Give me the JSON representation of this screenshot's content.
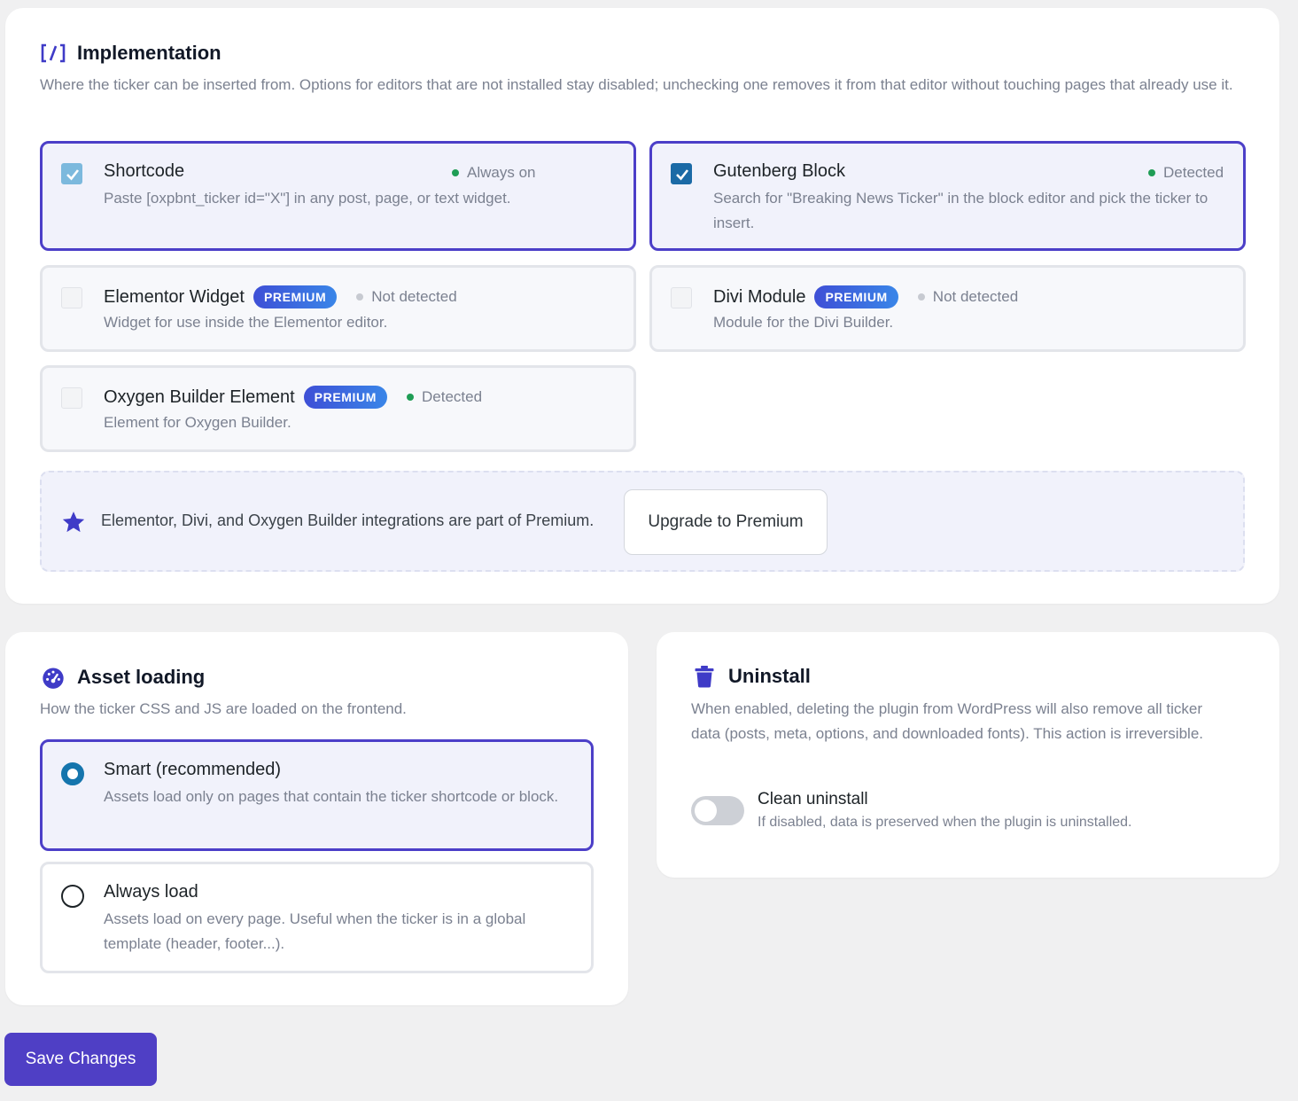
{
  "implementation": {
    "title": "Implementation",
    "description": "Where the ticker can be inserted from. Options for editors that are not installed stay disabled; unchecking one removes it from that editor without touching pages that already use it.",
    "options": [
      {
        "title": "Shortcode",
        "status": "Always on",
        "description": "Paste [oxpbnt_ticker id=\"X\"] in any post, page, or text widget.",
        "checked": true
      },
      {
        "title": "Gutenberg Block",
        "status": "Detected",
        "description": "Search for \"Breaking News Ticker\" in the block editor and pick the ticker to insert.",
        "checked": true
      },
      {
        "title": "Elementor Widget",
        "badge": "PREMIUM",
        "status": "Not detected",
        "description": "Widget for use inside the Elementor editor.",
        "checked": false
      },
      {
        "title": "Divi Module",
        "badge": "PREMIUM",
        "status": "Not detected",
        "description": "Module for the Divi Builder.",
        "checked": false
      },
      {
        "title": "Oxygen Builder Element",
        "badge": "PREMIUM",
        "status": "Detected",
        "description": "Element for Oxygen Builder.",
        "checked": false
      }
    ],
    "promo": {
      "text": "Elementor, Divi, and Oxygen Builder integrations are part of Premium.",
      "button": "Upgrade to Premium"
    }
  },
  "asset_loading": {
    "title": "Asset loading",
    "description": "How the ticker CSS and JS are loaded on the frontend.",
    "options": [
      {
        "title": "Smart (recommended)",
        "description": "Assets load only on pages that contain the ticker shortcode or block.",
        "selected": true
      },
      {
        "title": "Always load",
        "description": "Assets load on every page. Useful when the ticker is in a global template (header, footer...).",
        "selected": false
      }
    ]
  },
  "uninstall": {
    "title": "Uninstall",
    "description": "When enabled, deleting the plugin from WordPress will also remove all ticker data (posts, meta, options, and downloaded fonts). This action is irreversible.",
    "toggle_label": "Clean uninstall",
    "toggle_description": "If disabled, data is preserved when the plugin is uninstalled.",
    "enabled": false
  },
  "save_button": "Save Changes",
  "colors": {
    "accent": "#4c3fc8",
    "checkbox_blue": "#1b6aa6",
    "detected_green": "#1f9d55",
    "premium_badge": "#3e4fd6"
  }
}
